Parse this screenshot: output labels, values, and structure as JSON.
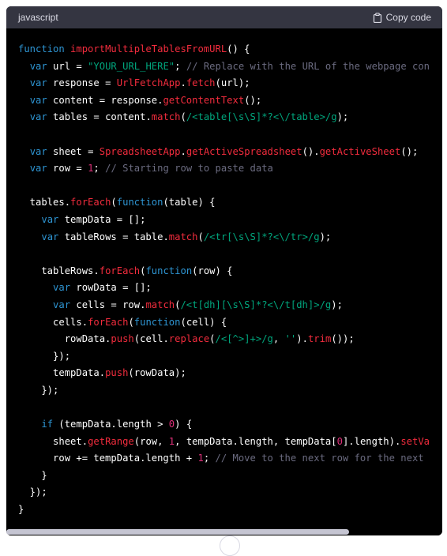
{
  "header": {
    "language": "javascript",
    "copy_label": "Copy code"
  },
  "colors": {
    "keyword": "#2e95d3",
    "function": "#f22c3d",
    "string": "#00a67d",
    "comment": "#6b6b80",
    "number": "#df3079",
    "text": "#ffffff",
    "background": "#000000",
    "header": "#343541"
  },
  "code_lines": [
    [
      [
        "kw",
        "function"
      ],
      [
        "id",
        " "
      ],
      [
        "fn",
        "importMultipleTablesFromURL"
      ],
      [
        "id",
        "() {"
      ]
    ],
    [
      [
        "id",
        "  "
      ],
      [
        "kw",
        "var"
      ],
      [
        "id",
        " url = "
      ],
      [
        "str",
        "\"YOUR_URL_HERE\""
      ],
      [
        "id",
        "; "
      ],
      [
        "cm",
        "// Replace with the URL of the webpage con"
      ]
    ],
    [
      [
        "id",
        "  "
      ],
      [
        "kw",
        "var"
      ],
      [
        "id",
        " response = "
      ],
      [
        "fn",
        "UrlFetchApp"
      ],
      [
        "id",
        "."
      ],
      [
        "fn",
        "fetch"
      ],
      [
        "id",
        "(url);"
      ]
    ],
    [
      [
        "id",
        "  "
      ],
      [
        "kw",
        "var"
      ],
      [
        "id",
        " content = response."
      ],
      [
        "fn",
        "getContentText"
      ],
      [
        "id",
        "();"
      ]
    ],
    [
      [
        "id",
        "  "
      ],
      [
        "kw",
        "var"
      ],
      [
        "id",
        " tables = content."
      ],
      [
        "fn",
        "match"
      ],
      [
        "id",
        "("
      ],
      [
        "rx",
        "/<table[\\s\\S]*?<\\/table>/g"
      ],
      [
        "id",
        ");"
      ]
    ],
    [
      [
        "id",
        ""
      ]
    ],
    [
      [
        "id",
        "  "
      ],
      [
        "kw",
        "var"
      ],
      [
        "id",
        " sheet = "
      ],
      [
        "fn",
        "SpreadsheetApp"
      ],
      [
        "id",
        "."
      ],
      [
        "fn",
        "getActiveSpreadsheet"
      ],
      [
        "id",
        "()."
      ],
      [
        "fn",
        "getActiveSheet"
      ],
      [
        "id",
        "();"
      ]
    ],
    [
      [
        "id",
        "  "
      ],
      [
        "kw",
        "var"
      ],
      [
        "id",
        " row = "
      ],
      [
        "num",
        "1"
      ],
      [
        "id",
        "; "
      ],
      [
        "cm",
        "// Starting row to paste data"
      ]
    ],
    [
      [
        "id",
        ""
      ]
    ],
    [
      [
        "id",
        "  tables."
      ],
      [
        "fn",
        "forEach"
      ],
      [
        "id",
        "("
      ],
      [
        "kw",
        "function"
      ],
      [
        "id",
        "(table) {"
      ]
    ],
    [
      [
        "id",
        "    "
      ],
      [
        "kw",
        "var"
      ],
      [
        "id",
        " tempData = [];"
      ]
    ],
    [
      [
        "id",
        "    "
      ],
      [
        "kw",
        "var"
      ],
      [
        "id",
        " tableRows = table."
      ],
      [
        "fn",
        "match"
      ],
      [
        "id",
        "("
      ],
      [
        "rx",
        "/<tr[\\s\\S]*?<\\/tr>/g"
      ],
      [
        "id",
        ");"
      ]
    ],
    [
      [
        "id",
        ""
      ]
    ],
    [
      [
        "id",
        "    tableRows."
      ],
      [
        "fn",
        "forEach"
      ],
      [
        "id",
        "("
      ],
      [
        "kw",
        "function"
      ],
      [
        "id",
        "(row) {"
      ]
    ],
    [
      [
        "id",
        "      "
      ],
      [
        "kw",
        "var"
      ],
      [
        "id",
        " rowData = [];"
      ]
    ],
    [
      [
        "id",
        "      "
      ],
      [
        "kw",
        "var"
      ],
      [
        "id",
        " cells = row."
      ],
      [
        "fn",
        "match"
      ],
      [
        "id",
        "("
      ],
      [
        "rx",
        "/<t[dh][\\s\\S]*?<\\/t[dh]>/g"
      ],
      [
        "id",
        ");"
      ]
    ],
    [
      [
        "id",
        "      cells."
      ],
      [
        "fn",
        "forEach"
      ],
      [
        "id",
        "("
      ],
      [
        "kw",
        "function"
      ],
      [
        "id",
        "(cell) {"
      ]
    ],
    [
      [
        "id",
        "        rowData."
      ],
      [
        "fn",
        "push"
      ],
      [
        "id",
        "(cell."
      ],
      [
        "fn",
        "replace"
      ],
      [
        "id",
        "("
      ],
      [
        "rx",
        "/<[^>]+>/g"
      ],
      [
        "id",
        ", "
      ],
      [
        "str",
        "''"
      ],
      [
        "id",
        ")."
      ],
      [
        "fn",
        "trim"
      ],
      [
        "id",
        "());"
      ]
    ],
    [
      [
        "id",
        "      });"
      ]
    ],
    [
      [
        "id",
        "      tempData."
      ],
      [
        "fn",
        "push"
      ],
      [
        "id",
        "(rowData);"
      ]
    ],
    [
      [
        "id",
        "    });"
      ]
    ],
    [
      [
        "id",
        ""
      ]
    ],
    [
      [
        "id",
        "    "
      ],
      [
        "kw",
        "if"
      ],
      [
        "id",
        " (tempData.length > "
      ],
      [
        "num",
        "0"
      ],
      [
        "id",
        ") {"
      ]
    ],
    [
      [
        "id",
        "      sheet."
      ],
      [
        "fn",
        "getRange"
      ],
      [
        "id",
        "(row, "
      ],
      [
        "num",
        "1"
      ],
      [
        "id",
        ", tempData.length, tempData["
      ],
      [
        "num",
        "0"
      ],
      [
        "id",
        "].length)."
      ],
      [
        "fn",
        "setVa"
      ]
    ],
    [
      [
        "id",
        "      row += tempData.length + "
      ],
      [
        "num",
        "1"
      ],
      [
        "id",
        "; "
      ],
      [
        "cm",
        "// Move to the next row for the next"
      ]
    ],
    [
      [
        "id",
        "    }"
      ]
    ],
    [
      [
        "id",
        "  });"
      ]
    ],
    [
      [
        "id",
        "}"
      ]
    ]
  ]
}
